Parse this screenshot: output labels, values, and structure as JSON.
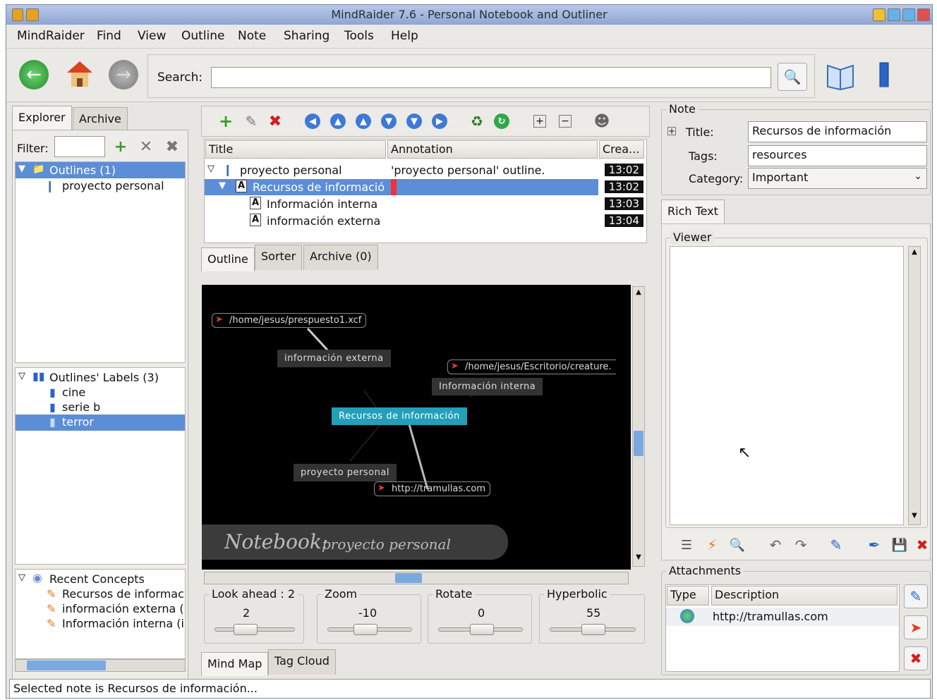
{
  "window": {
    "title": "MindRaider 7.6 - Personal Notebook and Outliner"
  },
  "menu": [
    "MindRaider",
    "Find",
    "View",
    "Outline",
    "Note",
    "Sharing",
    "Tools",
    "Help"
  ],
  "search": {
    "label": "Search:",
    "value": ""
  },
  "left": {
    "tabs": [
      "Explorer",
      "Archive"
    ],
    "filter_label": "Filter:",
    "outlines_root": "Outlines (1)",
    "outline_item": "proyecto personal",
    "labels_root": "Outlines' Labels (3)",
    "labels": [
      "cine",
      "serie b",
      "terror"
    ],
    "recent_root": "Recent Concepts",
    "recent": [
      "Recursos de informac",
      "información externa (",
      "Información interna (i"
    ]
  },
  "outline": {
    "columns": [
      "Title",
      "Annotation",
      "Crea..."
    ],
    "rows": [
      {
        "title": "proyecto personal",
        "annotation": "'proyecto personal' outline.",
        "time": "13:02"
      },
      {
        "title": "Recursos de informació",
        "annotation": "",
        "time": "13:02"
      },
      {
        "title": "Información interna",
        "annotation": "",
        "time": "13:03"
      },
      {
        "title": "información externa",
        "annotation": "",
        "time": "13:04"
      }
    ],
    "tabs": [
      "Outline",
      "Sorter",
      "Archive (0)"
    ]
  },
  "mindmap": {
    "nodes": [
      "información externa",
      "Información interna",
      "Recursos de información",
      "proyecto personal"
    ],
    "links": [
      "/home/jesus/prespuesto1.xcf",
      "/home/jesus/Escritorio/creature.",
      "http://tramullas.com"
    ],
    "notebook_label": "Notebook:",
    "notebook_name": "proyecto personal",
    "controls": [
      {
        "label": "Look ahead : 2",
        "value": "2"
      },
      {
        "label": "Zoom",
        "value": "-10"
      },
      {
        "label": "Rotate",
        "value": "0"
      },
      {
        "label": "Hyperbolic",
        "value": "55"
      }
    ],
    "tabs": [
      "Mind Map",
      "Tag Cloud"
    ]
  },
  "note": {
    "group": "Note",
    "title_label": "Title:",
    "title_value": "Recursos de información",
    "tags_label": "Tags:",
    "tags_value": "resources",
    "category_label": "Category:",
    "category_value": "Important",
    "tab": "Rich Text",
    "viewer": "Viewer",
    "attachments": "Attachments",
    "att_columns": [
      "Type",
      "Description"
    ],
    "att_rows": [
      {
        "description": "http://tramullas.com"
      }
    ]
  },
  "status": "Selected note is Recursos de información..."
}
